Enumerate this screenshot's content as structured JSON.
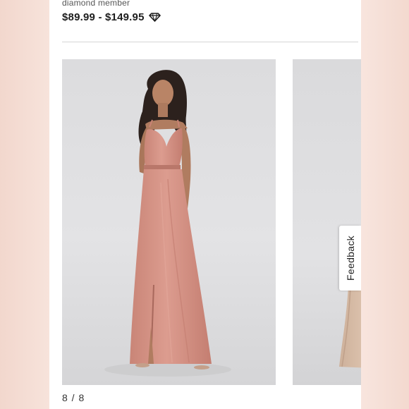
{
  "product": {
    "member_label": "diamond member",
    "price_range": "$89.99 - $149.95",
    "member_icon": "diamond-icon"
  },
  "gallery": {
    "counter": "8 / 8",
    "main_image": "rose dress model photo",
    "next_image": "champagne dress model photo"
  },
  "feedback": {
    "label": "Feedback"
  },
  "colors": {
    "dress_main": "#d9968a",
    "dress_next": "#d8bda6",
    "photo_bg": "#dedee0"
  }
}
